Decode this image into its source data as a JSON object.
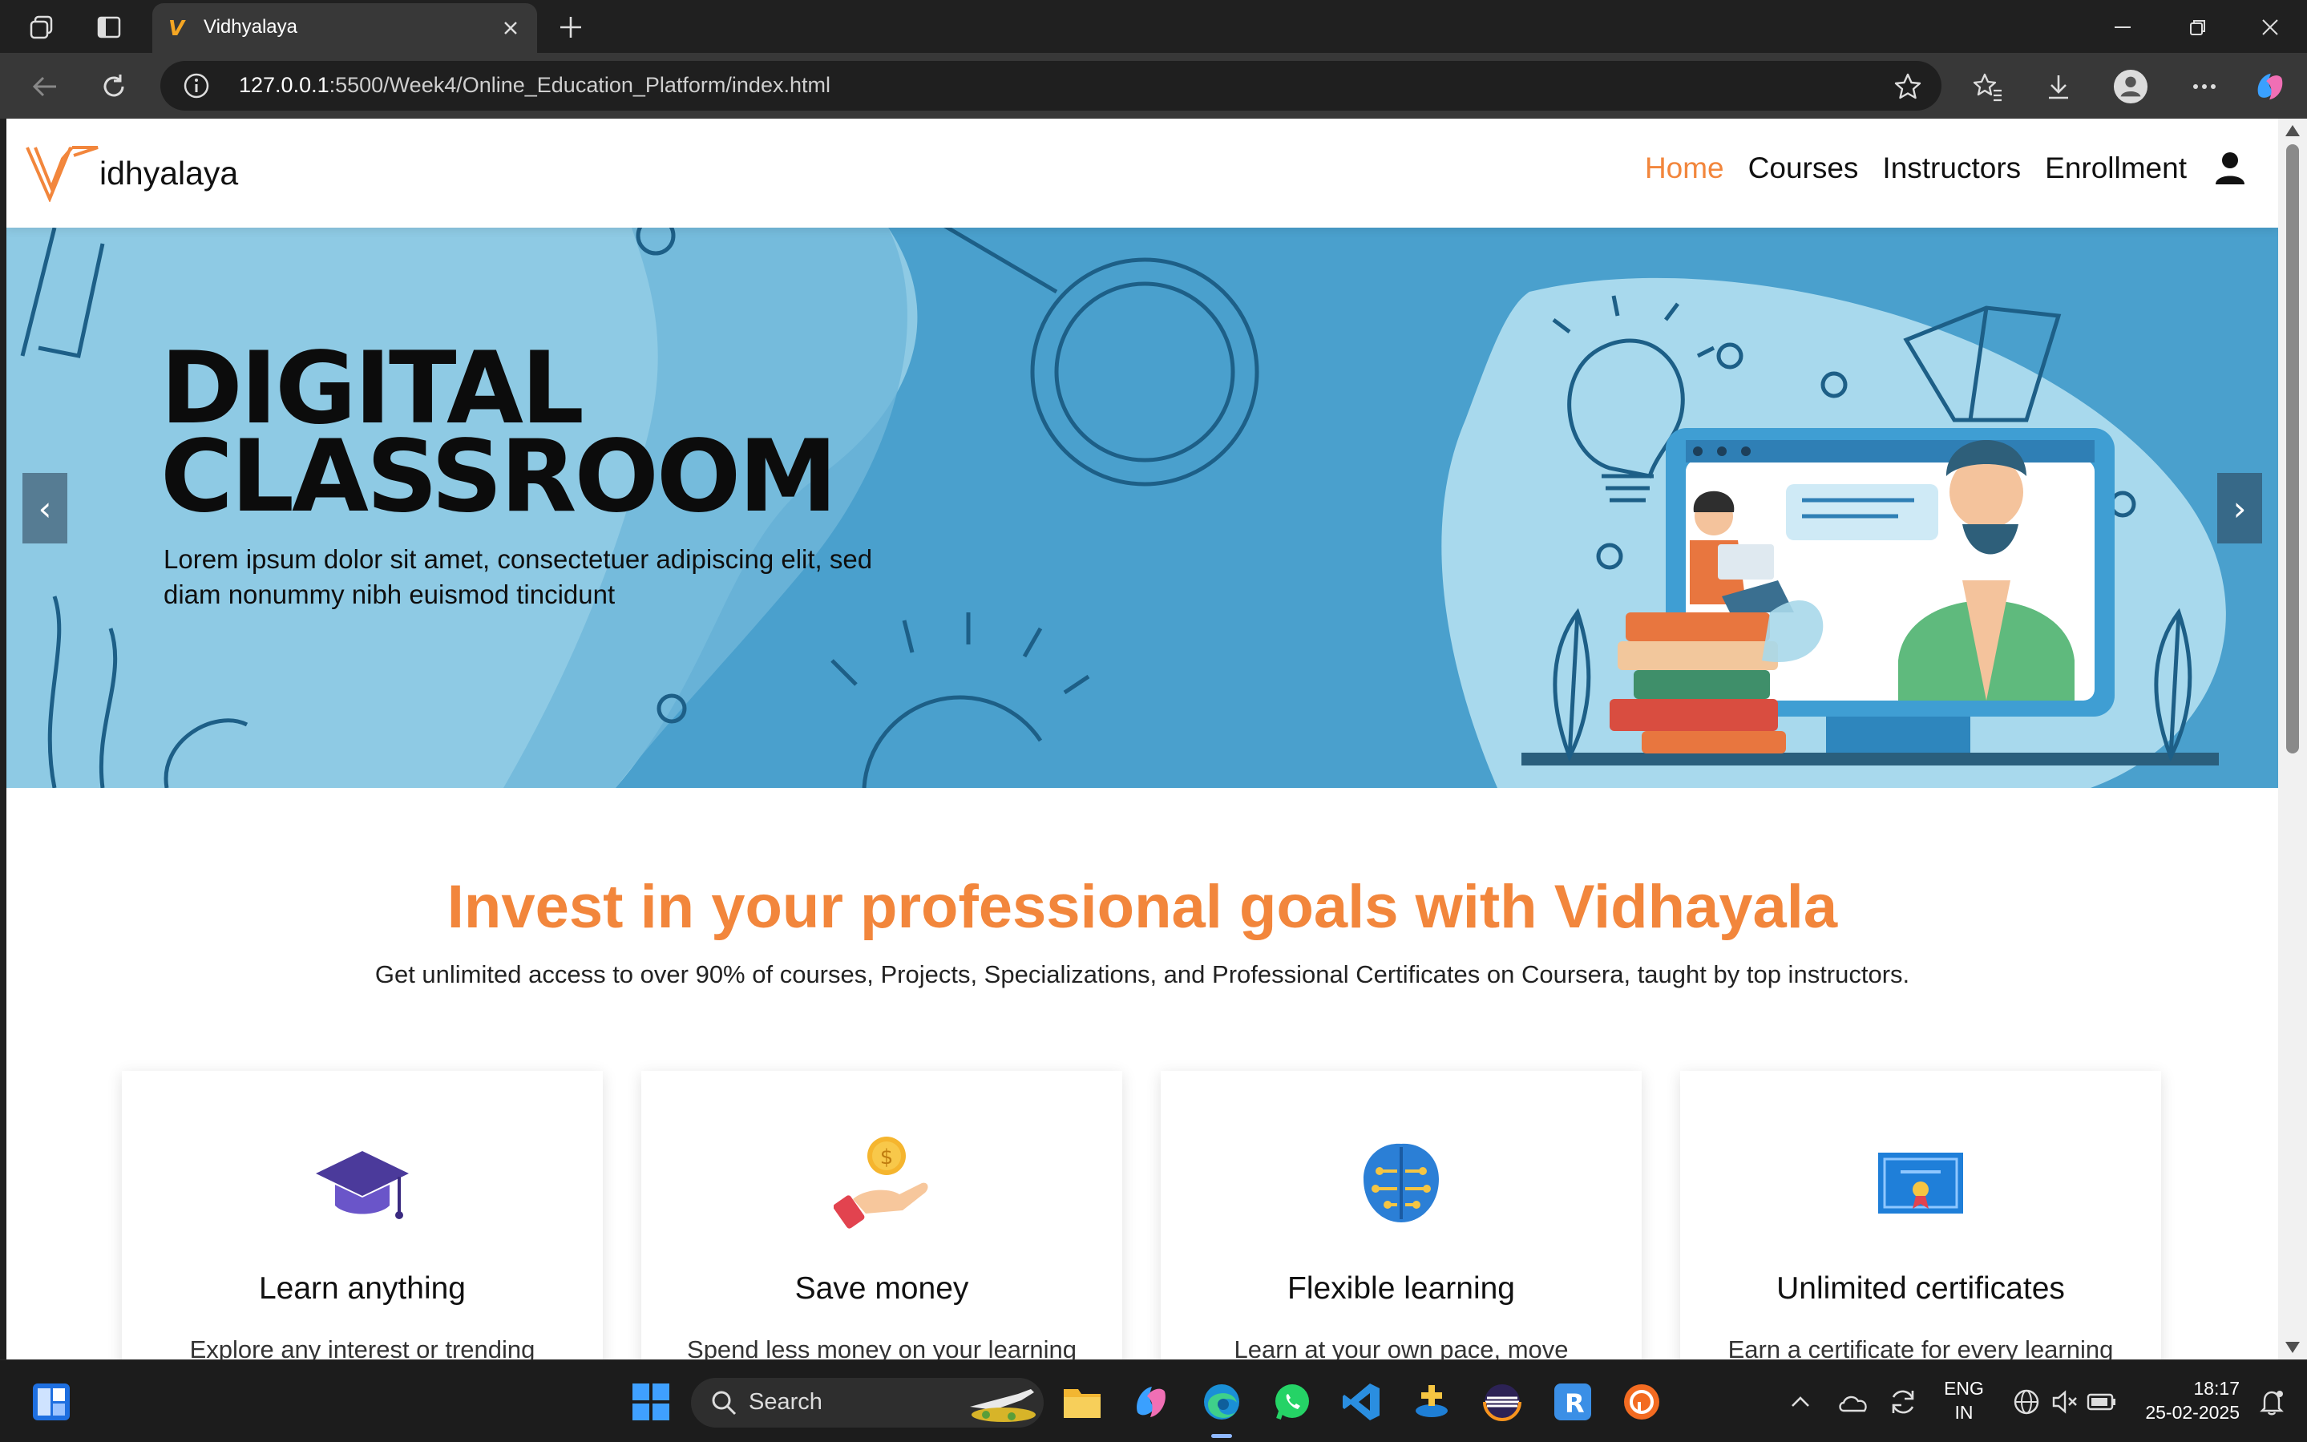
{
  "browser": {
    "tab_title": "Vidhyalaya",
    "tab_favicon": "V",
    "url_host": "127.0.0.1",
    "url_rest": ":5500/Week4/Online_Education_Platform/index.html"
  },
  "site": {
    "logo_text": "idhyalaya",
    "nav": [
      "Home",
      "Courses",
      "Instructors",
      "Enrollment"
    ],
    "active_nav": "Home",
    "accent_color": "#f2863c"
  },
  "hero": {
    "title": "DIGITAL\nCLASSROOM",
    "subtitle": "Lorem ipsum dolor sit amet, consectetuer adipiscing elit, sed diam nonummy nibh euismod tincidunt",
    "prev_label": "‹",
    "next_label": "›"
  },
  "intro": {
    "title": "Invest in your professional goals with Vidhayala",
    "subtitle": "Get unlimited access to over 90% of courses, Projects, Specializations, and Professional Certificates on Coursera, taught by top instructors."
  },
  "features": [
    {
      "icon": "graduation-cap-icon",
      "title": "Learn anything",
      "text": "Explore any interest or trending"
    },
    {
      "icon": "save-money-icon",
      "title": "Save money",
      "text": "Spend less money on your learning"
    },
    {
      "icon": "brain-icon",
      "title": "Flexible learning",
      "text": "Learn at your own pace, move"
    },
    {
      "icon": "certificate-icon",
      "title": "Unlimited certificates",
      "text": "Earn a certificate for every learning"
    }
  ],
  "taskbar": {
    "search_label": "Search",
    "lang_line1": "ENG",
    "lang_line2": "IN",
    "time": "18:17",
    "date": "25-02-2025"
  }
}
